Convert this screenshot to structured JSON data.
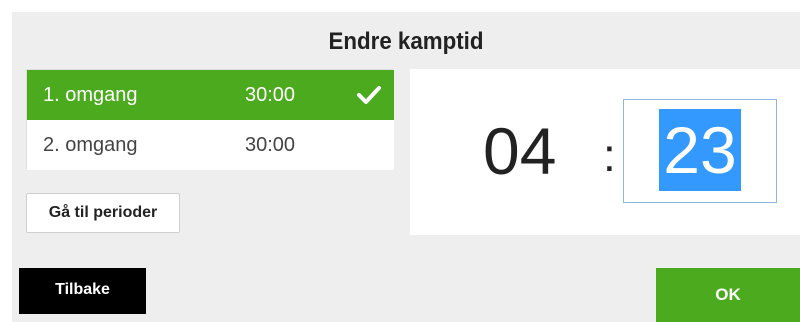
{
  "dialog": {
    "title": "Endre kamptid",
    "periods": [
      {
        "name": "1. omgang",
        "time": "30:00",
        "selected": true
      },
      {
        "name": "2. omgang",
        "time": "30:00",
        "selected": false
      }
    ],
    "goto_periods_label": "Gå til perioder",
    "clock": {
      "minutes": "04",
      "separator": ":",
      "seconds": "23"
    },
    "back_label": "Tilbake",
    "ok_label": "OK"
  },
  "icons": {
    "selected_period": "check-icon"
  },
  "colors": {
    "accent_green": "#4caa1e",
    "selection_blue": "#3399ff",
    "dialog_background": "#eeeeee",
    "back_button": "#000000"
  }
}
